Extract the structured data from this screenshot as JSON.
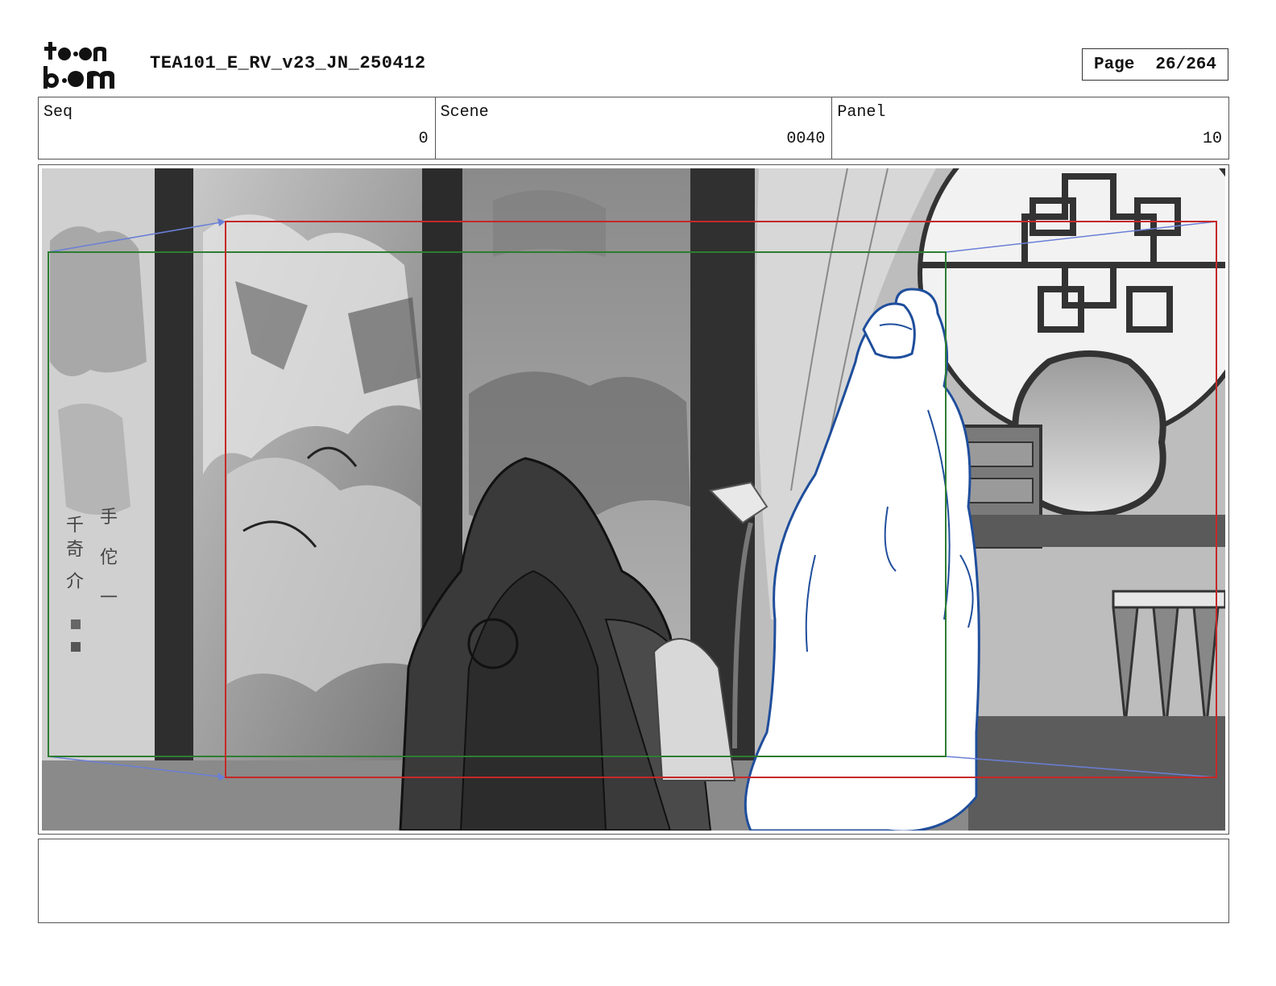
{
  "header": {
    "logo_text": "toon boom",
    "document_title": "TEA101_E_RV_v23_JN_250412",
    "page_label": "Page",
    "page_value": "26/264"
  },
  "meta": {
    "seq_label": "Seq",
    "seq_value": "0",
    "scene_label": "Scene",
    "scene_value": "0040",
    "panel_label": "Panel",
    "panel_value": "10"
  },
  "frames": {
    "camera_start_color": "#2e7d32",
    "camera_end_color": "#c62828",
    "motion_arrow_color": "#6a7fd6",
    "character_outline_color": "#1f4e9c"
  },
  "notes": {
    "text": ""
  }
}
